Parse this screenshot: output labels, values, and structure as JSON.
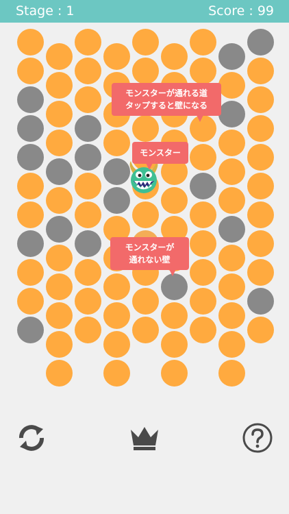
{
  "header": {
    "stage_text": "Stage : 1",
    "score_text": "Score : 99"
  },
  "tutorial": {
    "road_tip_line1": "モンスターが通れる道",
    "road_tip_line2": "タップすると壁になる",
    "monster_tip": "モンスター",
    "wall_tip_line1": "モンスターが",
    "wall_tip_line2": "通れない壁"
  },
  "colors": {
    "header": "#6cc7c2",
    "road": "#ffaa3f",
    "wall": "#898989",
    "callout": "#f26a6a",
    "background": "#f0f0f0"
  },
  "controls": [
    "refresh-icon",
    "crown-icon",
    "question-icon"
  ],
  "board": {
    "columns": 9,
    "rows": 11,
    "cells": [
      [
        "o",
        "o",
        "o",
        "o",
        "o",
        "o",
        "o",
        "g",
        "g"
      ],
      [
        "o",
        "o",
        "o",
        "o",
        "o",
        "o",
        "o",
        "o",
        "o"
      ],
      [
        "g",
        "o",
        "o",
        "o",
        "o",
        "o",
        "o",
        "g",
        "o"
      ],
      [
        "g",
        "o",
        "g",
        "o",
        "o",
        "o",
        "o",
        "o",
        "o"
      ],
      [
        "g",
        "g",
        "g",
        "g",
        "o",
        "o",
        "o",
        "o",
        "o"
      ],
      [
        "o",
        "o",
        "o",
        "g",
        "o",
        "o",
        "g",
        "o",
        "o"
      ],
      [
        "o",
        "g",
        "o",
        "o",
        "o",
        "o",
        "o",
        "g",
        "o"
      ],
      [
        "g",
        "o",
        "g",
        "o",
        "h",
        "o",
        "o",
        "o",
        "o"
      ],
      [
        "o",
        "o",
        "o",
        "o",
        "o",
        "g",
        "o",
        "o",
        "o"
      ],
      [
        "o",
        "o",
        "o",
        "o",
        "o",
        "o",
        "o",
        "o",
        "g"
      ],
      [
        "g",
        "o",
        "o",
        "o",
        "o",
        "o",
        "o",
        "o",
        "o"
      ]
    ],
    "last_row": [
      "o",
      "o",
      "o",
      "o",
      "o",
      "o",
      "o",
      "o",
      "o"
    ],
    "monster": {
      "row": 5,
      "col": 4
    }
  }
}
